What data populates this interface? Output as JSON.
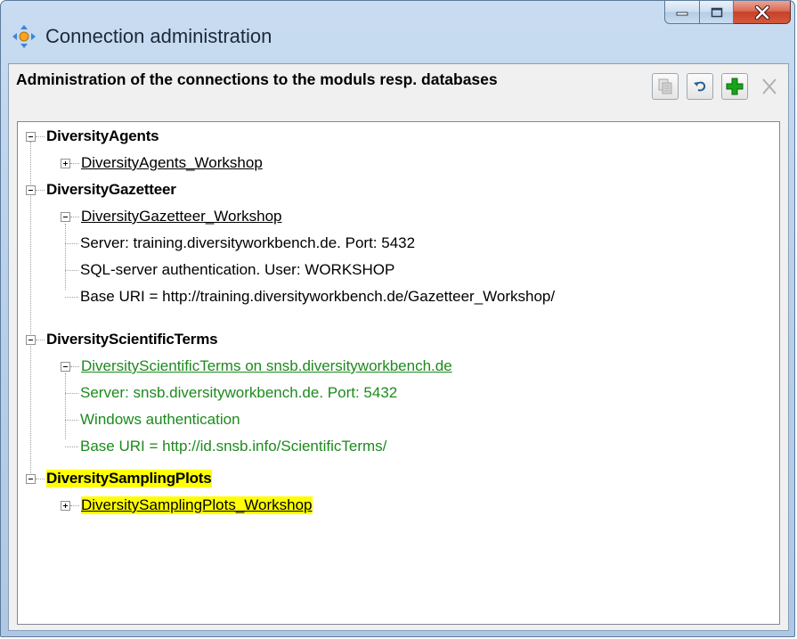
{
  "window": {
    "title": "Connection administration",
    "icon": "connection-icon"
  },
  "header": {
    "text": "Administration of the connections to the moduls resp. databases"
  },
  "toolbar": {
    "buttons": [
      {
        "name": "copy-icon",
        "enabled": false
      },
      {
        "name": "undo-icon",
        "enabled": true
      },
      {
        "name": "add-icon",
        "enabled": true
      },
      {
        "name": "remove-icon",
        "enabled": false
      }
    ]
  },
  "tree": {
    "nodes": [
      {
        "label": "DiversityAgents",
        "children": [
          {
            "label": "DiversityAgents_Workshop",
            "expanded": false
          }
        ]
      },
      {
        "label": "DiversityGazetteer",
        "children": [
          {
            "label": "DiversityGazetteer_Workshop",
            "expanded": true,
            "details": [
              "Server: training.diversityworkbench.de. Port: 5432",
              "SQL-server authentication. User: WORKSHOP",
              "Base URI = http://training.diversityworkbench.de/Gazetteer_Workshop/"
            ]
          }
        ]
      },
      {
        "label": "DiversityScientificTerms",
        "children": [
          {
            "label": "DiversityScientificTerms on snsb.diversityworkbench.de",
            "expanded": true,
            "color": "#1d8a1d",
            "details": [
              "Server: snsb.diversityworkbench.de. Port: 5432",
              "Windows authentication",
              "Base URI = http://id.snsb.info/ScientificTerms/"
            ]
          }
        ]
      },
      {
        "label": "DiversitySamplingPlots",
        "highlight": "#ffff00",
        "children": [
          {
            "label": "DiversitySamplingPlots_Workshop",
            "expanded": false,
            "highlight": "#ffff00"
          }
        ]
      }
    ]
  }
}
